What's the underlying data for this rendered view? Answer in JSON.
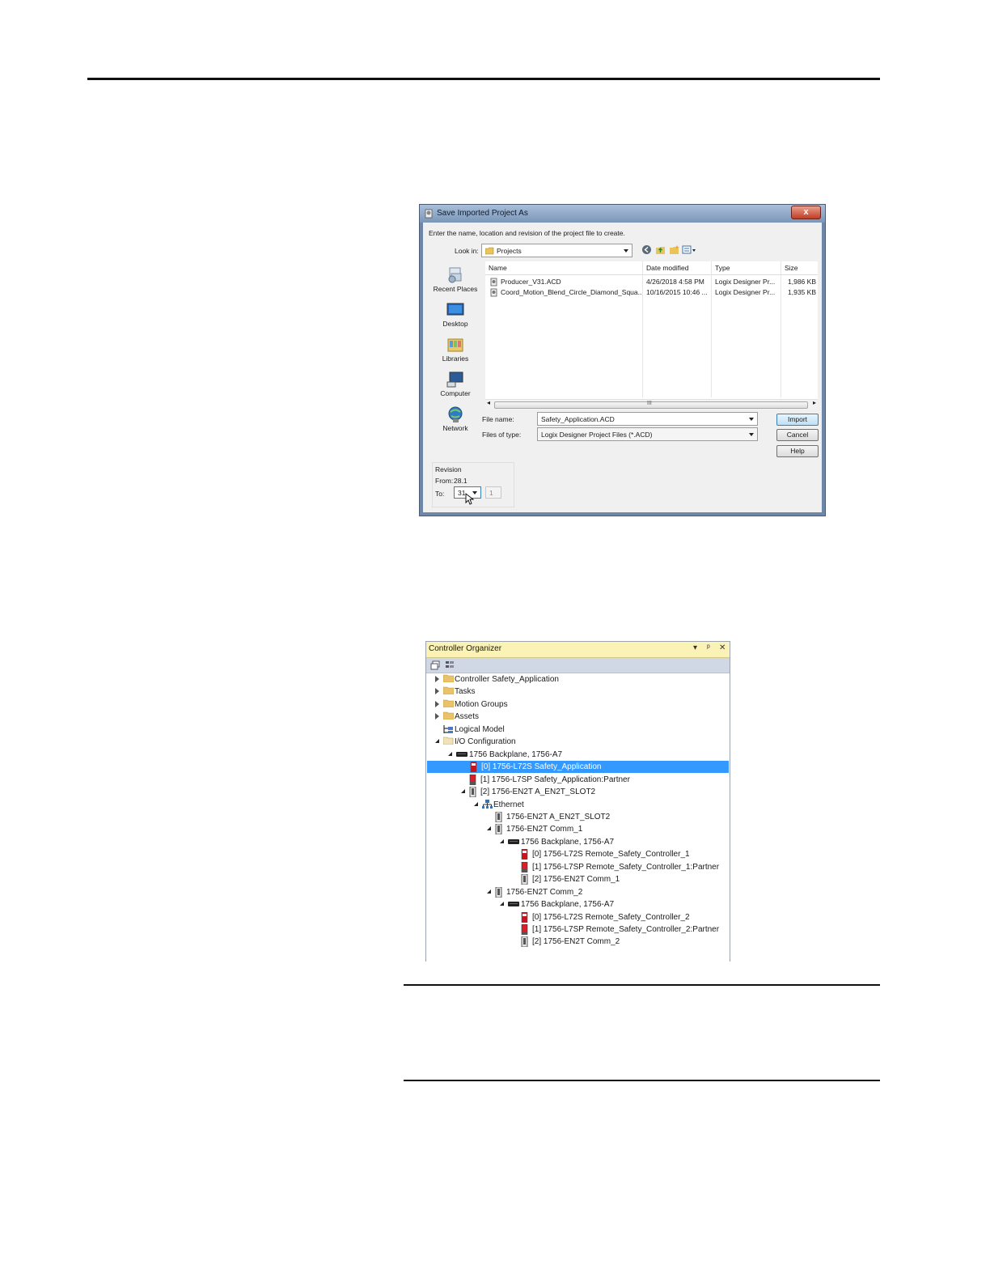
{
  "dialog": {
    "title": "Save Imported Project As",
    "close_label": "x",
    "instruction": "Enter the name, location and revision of the project file to create.",
    "look_in_label": "Look in:",
    "look_in_value": "Projects",
    "places": [
      "Recent Places",
      "Desktop",
      "Libraries",
      "Computer",
      "Network"
    ],
    "columns": [
      "Name",
      "Date modified",
      "Type",
      "Size"
    ],
    "files": [
      {
        "name": "Producer_V31.ACD",
        "date": "4/26/2018 4:58 PM",
        "type": "Logix Designer Pr...",
        "size": "1,986 KB"
      },
      {
        "name": "Coord_Motion_Blend_Circle_Diamond_Squa...",
        "date": "10/16/2015 10:46 ...",
        "type": "Logix Designer Pr...",
        "size": "1,935 KB"
      }
    ],
    "scroll_grip": "III",
    "file_name_label": "File name:",
    "file_name_value": "Safety_Application.ACD",
    "file_type_label": "Files of type:",
    "file_type_value": "Logix Designer Project Files (*.ACD)",
    "buttons": {
      "import": "Import",
      "cancel": "Cancel",
      "help": "Help"
    },
    "revision": {
      "label": "Revision",
      "from_label": "From:",
      "from_value": "28.1",
      "to_label": "To:",
      "to_value": "31",
      "minor_value": "1"
    }
  },
  "organizer": {
    "title": "Controller Organizer",
    "controls": {
      "menu": "▾",
      "pin": "ᵖ",
      "close": "✕"
    },
    "tree": [
      {
        "label": "Controller Safety_Application",
        "depth": 0,
        "icon": "folder",
        "state": "collapsed"
      },
      {
        "label": "Tasks",
        "depth": 0,
        "icon": "folder",
        "state": "collapsed"
      },
      {
        "label": "Motion Groups",
        "depth": 0,
        "icon": "folder",
        "state": "collapsed"
      },
      {
        "label": "Assets",
        "depth": 0,
        "icon": "folder",
        "state": "collapsed"
      },
      {
        "label": "Logical Model",
        "depth": 0,
        "icon": "logical-model",
        "state": "none"
      },
      {
        "label": "I/O Configuration",
        "depth": 0,
        "icon": "folder-open",
        "state": "open"
      },
      {
        "label": "1756 Backplane, 1756-A7",
        "depth": 1,
        "icon": "backplane",
        "state": "open"
      },
      {
        "label": "[0] 1756-L72S Safety_Application",
        "depth": 2,
        "icon": "safety-controller",
        "state": "none",
        "selected": true
      },
      {
        "label": "[1] 1756-L7SP Safety_Application:Partner",
        "depth": 2,
        "icon": "safety-partner",
        "state": "none"
      },
      {
        "label": "[2] 1756-EN2T A_EN2T_SLOT2",
        "depth": 2,
        "icon": "comm-module",
        "state": "open"
      },
      {
        "label": "Ethernet",
        "depth": 3,
        "icon": "network",
        "state": "open"
      },
      {
        "label": "1756-EN2T A_EN2T_SLOT2",
        "depth": 4,
        "icon": "comm-module",
        "state": "none"
      },
      {
        "label": "1756-EN2T Comm_1",
        "depth": 4,
        "icon": "comm-module",
        "state": "open"
      },
      {
        "label": "1756 Backplane, 1756-A7",
        "depth": 5,
        "icon": "backplane",
        "state": "open"
      },
      {
        "label": "[0] 1756-L72S Remote_Safety_Controller_1",
        "depth": 6,
        "icon": "safety-controller",
        "state": "none"
      },
      {
        "label": "[1] 1756-L7SP Remote_Safety_Controller_1:Partner",
        "depth": 6,
        "icon": "safety-partner",
        "state": "none"
      },
      {
        "label": "[2] 1756-EN2T Comm_1",
        "depth": 6,
        "icon": "comm-module",
        "state": "none"
      },
      {
        "label": "1756-EN2T Comm_2",
        "depth": 4,
        "icon": "comm-module",
        "state": "open"
      },
      {
        "label": "1756 Backplane, 1756-A7",
        "depth": 5,
        "icon": "backplane",
        "state": "open"
      },
      {
        "label": "[0] 1756-L72S Remote_Safety_Controller_2",
        "depth": 6,
        "icon": "safety-controller",
        "state": "none"
      },
      {
        "label": "[1] 1756-L7SP Remote_Safety_Controller_2:Partner",
        "depth": 6,
        "icon": "safety-partner",
        "state": "none"
      },
      {
        "label": "[2] 1756-EN2T Comm_2",
        "depth": 6,
        "icon": "comm-module",
        "state": "none"
      }
    ]
  },
  "colors": {
    "selection": "#3399ff",
    "safety_red": "#c8141e",
    "organizer_title": "#fbf2b5"
  }
}
